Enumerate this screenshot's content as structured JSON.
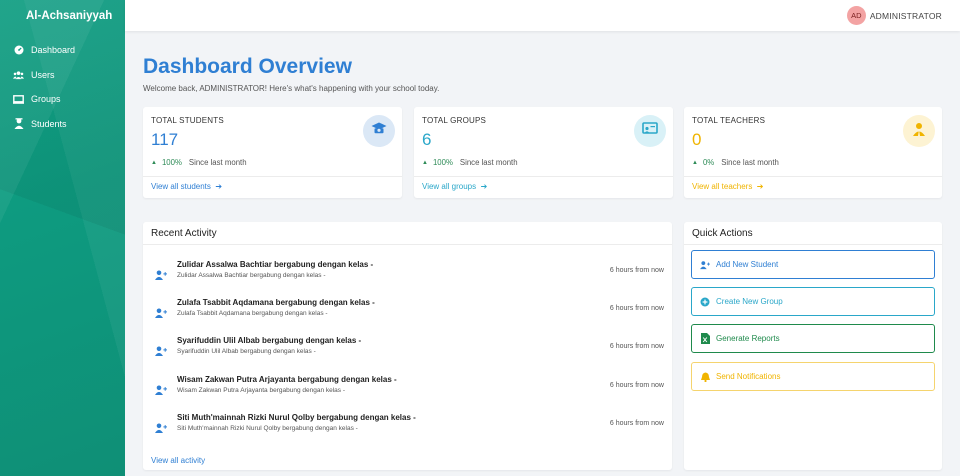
{
  "brand": "Al-Achsaniyyah",
  "sidebar": {
    "items": [
      {
        "label": "Dashboard",
        "icon": "dashboard-icon"
      },
      {
        "label": "Users",
        "icon": "users-icon"
      },
      {
        "label": "Groups",
        "icon": "groups-icon"
      },
      {
        "label": "Students",
        "icon": "students-icon"
      }
    ]
  },
  "topbar": {
    "avatar_initials": "AD",
    "user_name": "ADMINISTRATOR"
  },
  "header": {
    "title": "Dashboard Overview",
    "subtitle": "Welcome back, ADMINISTRATOR! Here's what's happening with your school today."
  },
  "stats": [
    {
      "label": "TOTAL STUDENTS",
      "value": "117",
      "pct": "100%",
      "since": "Since last month",
      "link": "View all students",
      "color": "#2f7fd3",
      "badge_bg": "#dbe8f6",
      "icon": "graduation-cap-icon"
    },
    {
      "label": "TOTAL GROUPS",
      "value": "6",
      "pct": "100%",
      "since": "Since last month",
      "link": "View all groups",
      "color": "#2aa7c9",
      "badge_bg": "#d9f1f7",
      "icon": "chalkboard-icon"
    },
    {
      "label": "TOTAL TEACHERS",
      "value": "0",
      "pct": "0%",
      "since": "Since last month",
      "link": "View all teachers",
      "color": "#f0b400",
      "badge_bg": "#fdf3d3",
      "icon": "teacher-icon"
    }
  ],
  "recent": {
    "title": "Recent Activity",
    "view_all": "View all activity",
    "items": [
      {
        "title": "Zulidar Assalwa Bachtiar bergabung dengan kelas -",
        "desc": "Zulidar Assalwa Bachtiar bergabung dengan kelas -",
        "time": "6 hours from now"
      },
      {
        "title": "Zulafa Tsabbit Aqdamana bergabung dengan kelas -",
        "desc": "Zulafa Tsabbit Aqdamana bergabung dengan kelas -",
        "time": "6 hours from now"
      },
      {
        "title": "Syarifuddin Ulil Albab bergabung dengan kelas -",
        "desc": "Syarifuddin Ulil Albab bergabung dengan kelas -",
        "time": "6 hours from now"
      },
      {
        "title": "Wisam Zakwan Putra Arjayanta bergabung dengan kelas -",
        "desc": "Wisam Zakwan Putra Arjayanta bergabung dengan kelas -",
        "time": "6 hours from now"
      },
      {
        "title": "Siti Muth'mainnah Rizki Nurul Qolby bergabung dengan kelas -",
        "desc": "Siti Muth'mainnah Rizki Nurul Qolby bergabung dengan kelas -",
        "time": "6 hours from now"
      }
    ]
  },
  "quick": {
    "title": "Quick Actions",
    "actions": [
      {
        "label": "Add New Student",
        "color": "#2f7fd3",
        "icon": "user-plus-icon"
      },
      {
        "label": "Create New Group",
        "color": "#2aa7c9",
        "icon": "plus-circle-icon"
      },
      {
        "label": "Generate Reports",
        "color": "#1f8a4c",
        "icon": "file-excel-icon"
      },
      {
        "label": "Send Notifications",
        "color": "#f0b400",
        "icon": "bell-icon"
      }
    ]
  }
}
